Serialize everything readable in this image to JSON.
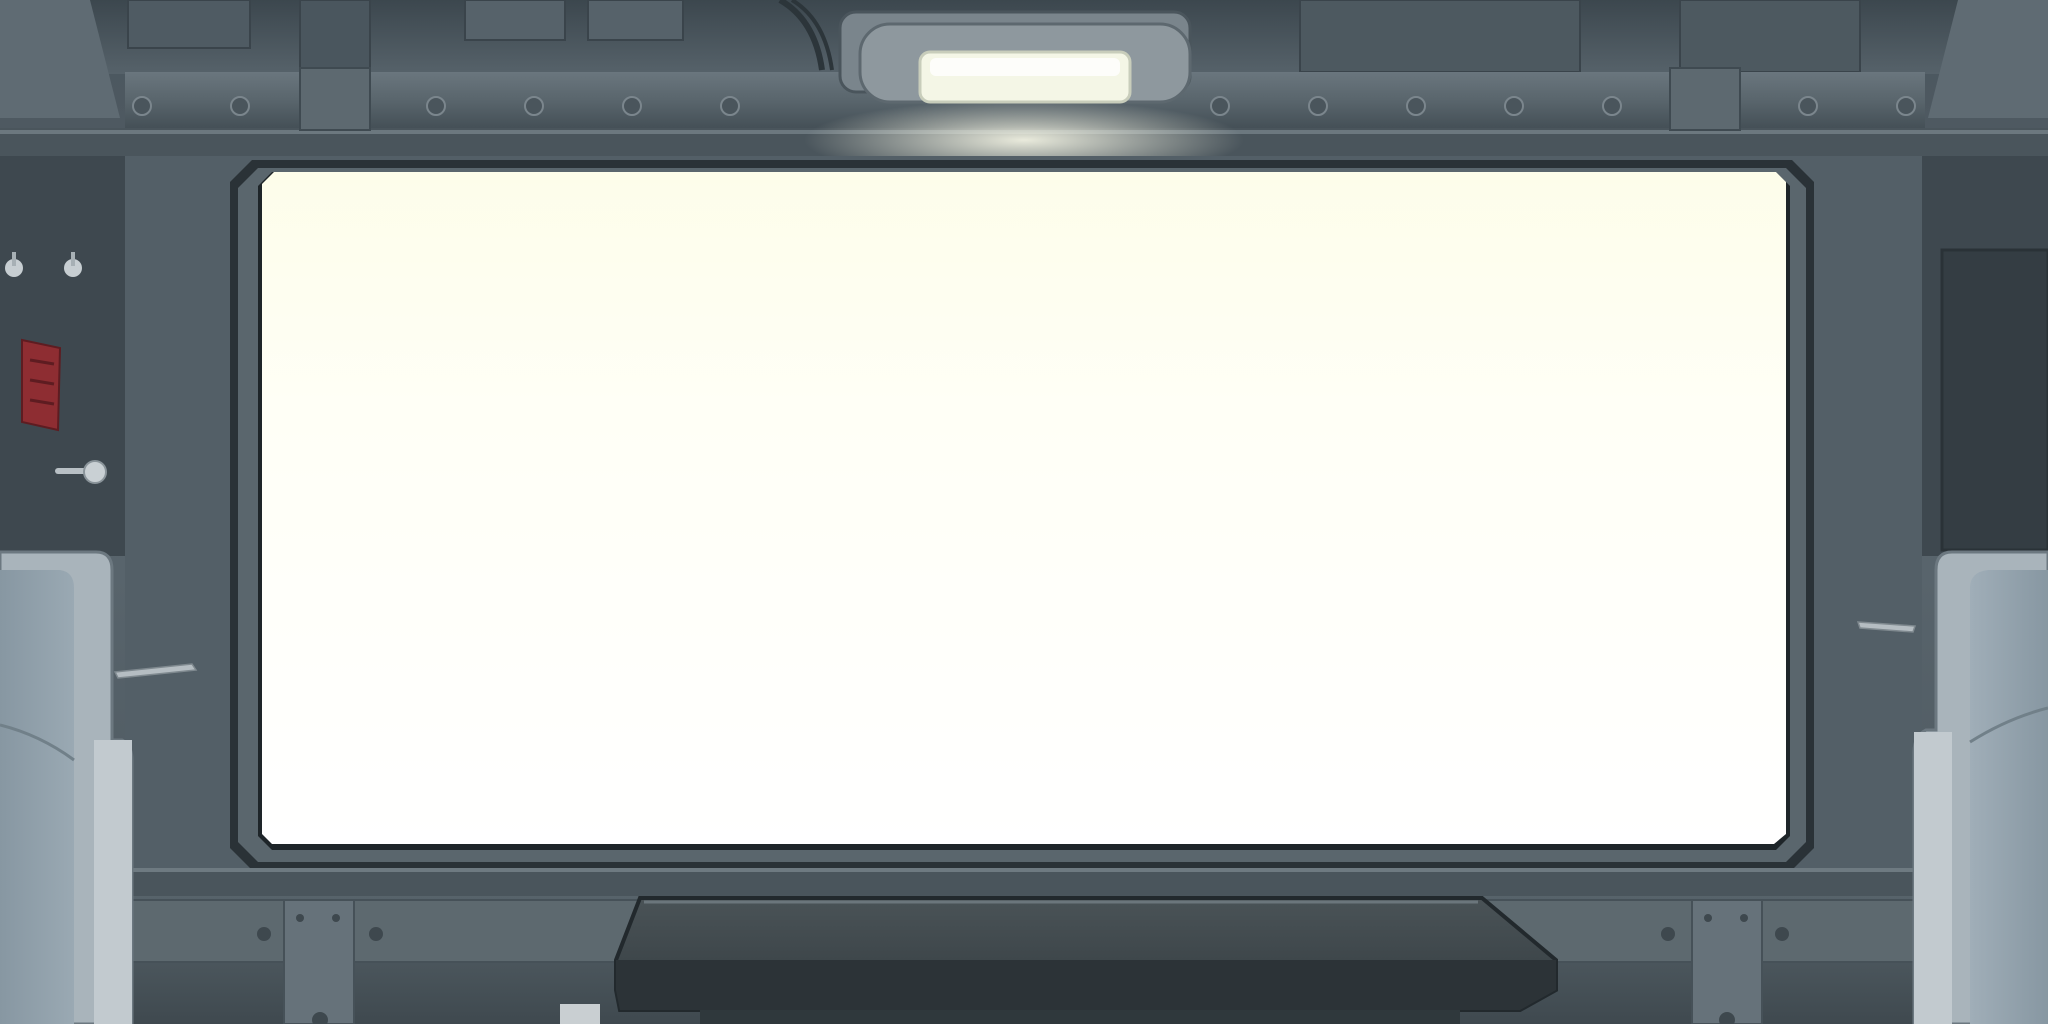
{
  "colors": {
    "wall": "#56626a",
    "wall_dark": "#3b454c",
    "frame": "#2a3237",
    "window_light": "#fffff4",
    "lamp_glow": "#f4f6e6",
    "seat_fabric": "#8a9aa6",
    "table_top": "#3a4246",
    "hook_red": "#8e2d32"
  },
  "icons": [
    "ceiling-lamp-icon",
    "toggle-switch-icon",
    "coat-hook-icon",
    "window-latch-icon",
    "door-handle-icon"
  ]
}
